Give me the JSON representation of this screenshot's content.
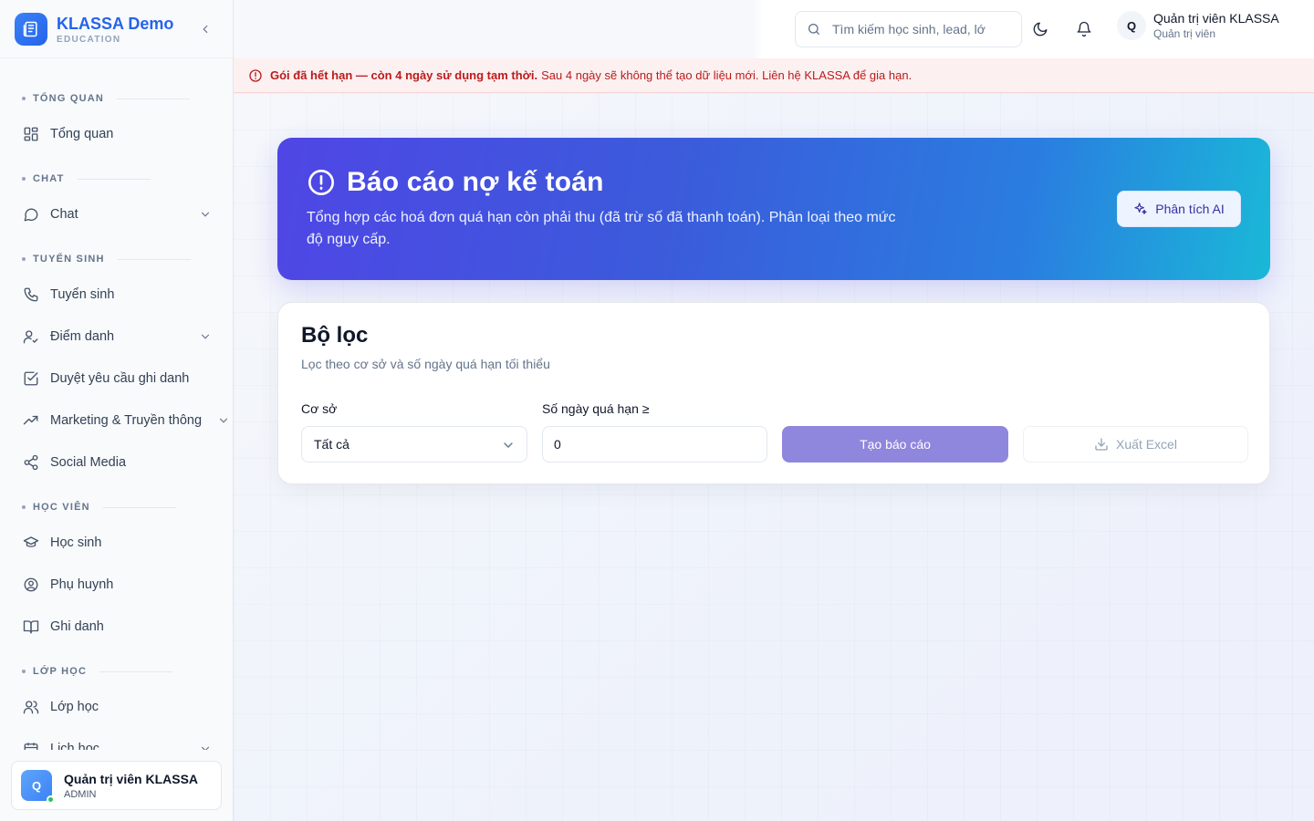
{
  "brand": {
    "title": "KLASSA Demo",
    "subtitle": "EDUCATION"
  },
  "sidebar": {
    "groups": [
      {
        "section": "TỔNG QUAN",
        "items": [
          {
            "label": "Tổng quan",
            "icon": "dashboard-icon",
            "has_submenu": false
          }
        ]
      },
      {
        "section": "CHAT",
        "items": [
          {
            "label": "Chat",
            "icon": "chat-icon",
            "has_submenu": true
          }
        ]
      },
      {
        "section": "TUYỂN SINH",
        "items": [
          {
            "label": "Tuyển sinh",
            "icon": "phone-icon",
            "has_submenu": false
          },
          {
            "label": "Điểm danh",
            "icon": "user-check-icon",
            "has_submenu": true
          },
          {
            "label": "Duyệt yêu cầu ghi danh",
            "icon": "checkbox-icon",
            "has_submenu": false
          },
          {
            "label": "Marketing & Truyền thông",
            "icon": "trending-icon",
            "has_submenu": true
          },
          {
            "label": "Social Media",
            "icon": "share-icon",
            "has_submenu": false
          }
        ]
      },
      {
        "section": "HỌC VIÊN",
        "items": [
          {
            "label": "Học sinh",
            "icon": "graduation-cap-icon",
            "has_submenu": false
          },
          {
            "label": "Phụ huynh",
            "icon": "user-circle-icon",
            "has_submenu": false
          },
          {
            "label": "Ghi danh",
            "icon": "book-open-icon",
            "has_submenu": false
          }
        ]
      },
      {
        "section": "LỚP HỌC",
        "items": [
          {
            "label": "Lớp học",
            "icon": "users-icon",
            "has_submenu": false
          },
          {
            "label": "Lịch học",
            "icon": "calendar-icon",
            "has_submenu": true
          }
        ]
      }
    ],
    "user": {
      "avatar": "Q",
      "name": "Quản trị viên KLASSA",
      "role": "ADMIN"
    }
  },
  "header": {
    "search_placeholder": "Tìm kiếm học sinh, lead, lớ",
    "user": {
      "avatar": "Q",
      "name": "Quản trị viên KLASSA",
      "role": "Quản trị viên"
    }
  },
  "alert": {
    "strong": "Gói đã hết hạn — còn 4 ngày sử dụng tạm thời.",
    "text": "Sau 4 ngày sẽ không thể tạo dữ liệu mới. Liên hệ KLASSA để gia hạn."
  },
  "hero": {
    "title": "Báo cáo nợ kế toán",
    "description": "Tổng hợp các hoá đơn quá hạn còn phải thu (đã trừ số đã thanh toán). Phân loại theo mức độ nguy cấp.",
    "ai_button": "Phân tích AI"
  },
  "filter": {
    "title": "Bộ lọc",
    "subtitle": "Lọc theo cơ sở và số ngày quá hạn tối thiểu",
    "branch_label": "Cơ sở",
    "branch_value": "Tất cả",
    "days_label": "Số ngày quá hạn ≥",
    "days_value": "0",
    "generate_button": "Tạo báo cáo",
    "export_button": "Xuất Excel"
  },
  "colors": {
    "brand": "#2563eb",
    "hero_start": "#4f46e5",
    "hero_end": "#1ab8d8",
    "alert_text": "#b91c1c",
    "generate_button": "#8f86dd"
  }
}
